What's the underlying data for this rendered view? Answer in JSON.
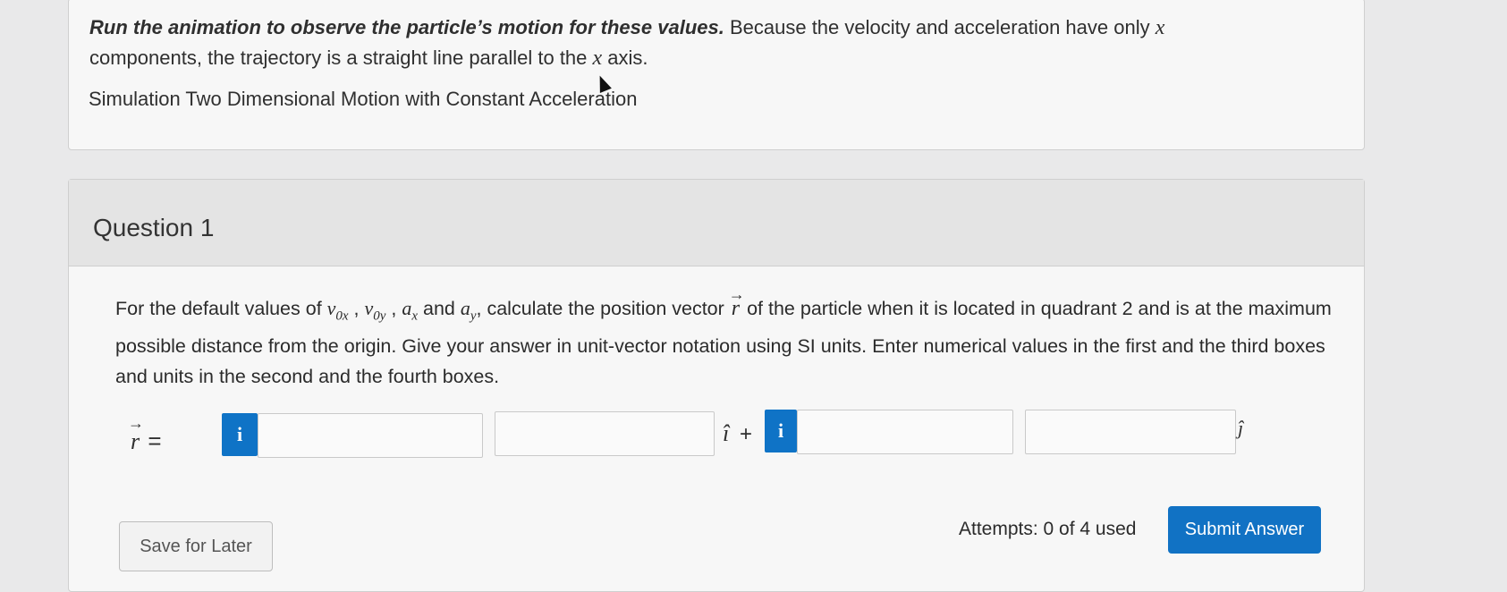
{
  "intro": {
    "bold_lead": "Run the animation to observe the particle’s motion for these values.",
    "text_part1": " Because the velocity and acceleration have only ",
    "var_x1": "x",
    "text_part2": " components, the trajectory is a straight line parallel to the ",
    "var_x2": "x",
    "text_part3": " axis."
  },
  "simulation_link": "Simulation Two Dimensional Motion with Constant Acceleration",
  "question": {
    "title": "Question 1",
    "text_a": "For the default values of ",
    "v0x_base": "v",
    "v0x_sub": "0x",
    "sep1": " , ",
    "v0y_base": "v",
    "v0y_sub": "0y",
    "sep2": " , ",
    "ax_base": "a",
    "ax_sub": "x",
    "text_and": " and ",
    "ay_base": "a",
    "ay_sub": "y",
    "text_b": ", calculate the position vector ",
    "r_symbol": "r",
    "text_c": " of the particle when it is located in quadrant 2 and is at the maximum possible distance from the origin. Give your answer in unit-vector notation using SI units. Enter numerical values in the first and the third boxes and units in the second and the fourth boxes."
  },
  "answer": {
    "r_symbol": "r",
    "equals": "=",
    "info_label": "i",
    "i_hat": "î",
    "plus": "+",
    "j_hat": "ĵ",
    "box1_value": "",
    "box2_value": "",
    "box3_value": "",
    "box4_value": ""
  },
  "footer": {
    "save_label": "Save for Later",
    "attempts": "Attempts: 0 of 4 used",
    "submit_label": "Submit Answer"
  },
  "colors": {
    "accent": "#1172c4",
    "info": "#0f73c6"
  }
}
